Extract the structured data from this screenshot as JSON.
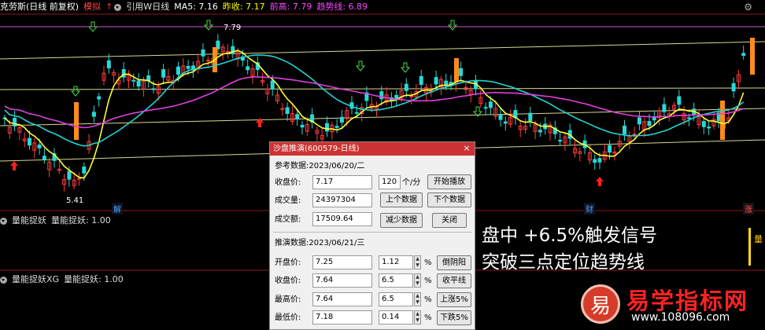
{
  "header": {
    "stock_name": "克劳斯",
    "period": "(日线 前复权)",
    "mode": "模拟",
    "indicator": "引用W日线",
    "ma5": "MA5: 7.16",
    "prev_close": "昨收: 7.17",
    "prev_high": "前高: 7.79",
    "trend_line": "趋势线: 6.89",
    "colors": {
      "stock": "#ffffff",
      "period": "#ffffff",
      "mode": "#ff4444",
      "indicator": "#dddddd",
      "ma5": "#ffffff",
      "prev_close": "#ffff00",
      "prev_high": "#ff44ff",
      "trend": "#ff44ff"
    }
  },
  "chart_labels": {
    "high_price": "7.79",
    "low_price": "5.41",
    "event_jie": "解",
    "event_cai": "财",
    "event_zhang": "涨"
  },
  "panel2": {
    "name": "量能捉妖",
    "value": "量能捉妖: 1.00"
  },
  "panel3": {
    "name": "量能捉妖XG",
    "value": "量能捉妖: 1.00"
  },
  "right_mark": "量",
  "dialog": {
    "title": "沙盘推演(600579-日线)",
    "ref_label": "参考数据:",
    "ref_date": "2023/06/20/二",
    "close_label": "收盘价:",
    "close_val": "7.17",
    "speed_val": "120",
    "speed_unit": "个/分",
    "start_btn": "开始播放",
    "vol_label": "成交量:",
    "vol_val": "24397304",
    "prev_btn": "上个数据",
    "next_btn": "下个数据",
    "amt_label": "成交额:",
    "amt_val": "17509.64",
    "reduce_btn": "减少数据",
    "close_btn": "关闭",
    "sim_label": "推演数据:",
    "sim_date": "2023/06/21/三",
    "open_label": "开盘价:",
    "open_val": "7.25",
    "open_pct": "1.12",
    "inverted_btn": "倒阴阳",
    "close2_label": "收盘价:",
    "close2_val": "7.64",
    "close2_pct": "6.5",
    "flat_btn": "收平线",
    "high_label": "最高价:",
    "high_val": "7.64",
    "high_pct": "6.5",
    "up5_btn": "上涨5%",
    "low_label": "最低价:",
    "low_val": "7.18",
    "low_pct": "0.14",
    "down5_btn": "下跌5%",
    "pct": "%"
  },
  "overlay": {
    "line1": "盘中 +6.5%触发信号",
    "line2": "突破三点定位趋势线"
  },
  "watermark": {
    "logo_char": "易",
    "site_name": "易学指标网",
    "url": "www.108096.com"
  }
}
